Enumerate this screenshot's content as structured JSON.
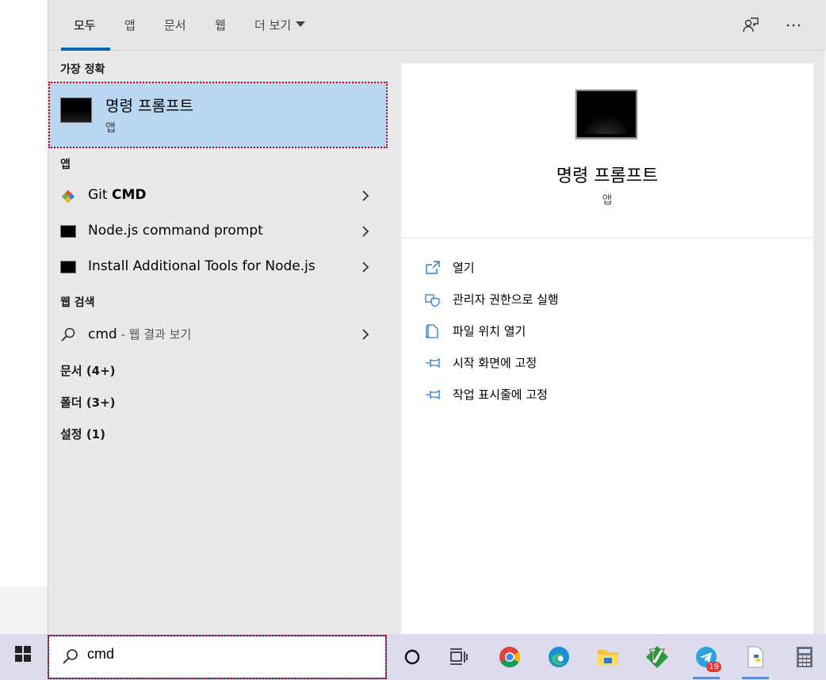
{
  "filter_tabs": [
    {
      "label": "모두"
    },
    {
      "label": "앱"
    },
    {
      "label": "문서"
    },
    {
      "label": "웹"
    },
    {
      "label": "더 보기"
    }
  ],
  "top_icons": [
    "feedback-icon",
    "more-options-icon"
  ],
  "sections": {
    "best_match": "가장 정확",
    "apps": "앱",
    "web_search": "웹 검색"
  },
  "best_match": {
    "title": "명령 프롬프트",
    "type": "앱"
  },
  "apps": [
    {
      "name_prefix": "Git ",
      "name_bold": "CMD",
      "icon": "git-icon"
    },
    {
      "name": "Node.js command prompt",
      "icon": "terminal-icon"
    },
    {
      "name": "Install Additional Tools for Node.js",
      "icon": "terminal-icon"
    }
  ],
  "web_result": {
    "query": "cmd",
    "hint": " - 웹 결과 보기"
  },
  "categories": [
    {
      "label": "문서 (4+)"
    },
    {
      "label": "폴더 (3+)"
    },
    {
      "label": "설정 (1)"
    }
  ],
  "detail": {
    "title": "명령 프롬프트",
    "type": "앱",
    "actions": [
      {
        "label": "열기",
        "icon": "open-icon"
      },
      {
        "label": "관리자 권한으로 실행",
        "icon": "admin-shield-icon"
      },
      {
        "label": "파일 위치 열기",
        "icon": "file-location-icon"
      },
      {
        "label": "시작 화면에 고정",
        "icon": "pin-icon"
      },
      {
        "label": "작업 표시줄에 고정",
        "icon": "pin-icon"
      }
    ]
  },
  "taskbar": {
    "search_value": "cmd",
    "telegram_badge": "19",
    "apps": [
      "cortana-icon",
      "task-view-icon",
      "chrome-icon",
      "edge-icon",
      "file-explorer-icon",
      "vim-icon",
      "telegram-icon",
      "python-file-icon",
      "calculator-icon"
    ]
  },
  "colors": {
    "selected_bg": "#b9d7f0",
    "accent": "#0067c0",
    "highlight_outline": "#d40000"
  }
}
